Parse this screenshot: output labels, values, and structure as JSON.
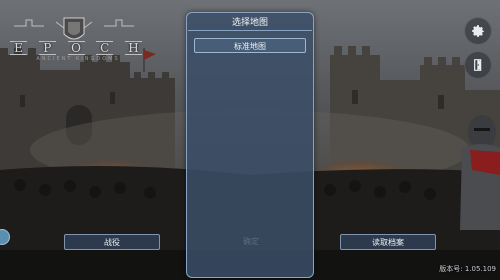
{
  "logo": {
    "letters": [
      "E",
      "P",
      "O",
      "C",
      "H"
    ],
    "subtitle": "ANCIENT KINGDOMS"
  },
  "map_dialog": {
    "title": "选择地图",
    "maps": [
      "标准地图"
    ],
    "hidden_button": "确定"
  },
  "buttons": {
    "battle": "战役",
    "load": "读取档案"
  },
  "icons": {
    "settings": "gear-icon",
    "exit": "exit-door-icon"
  },
  "version": "版本号: 1.05.109"
}
